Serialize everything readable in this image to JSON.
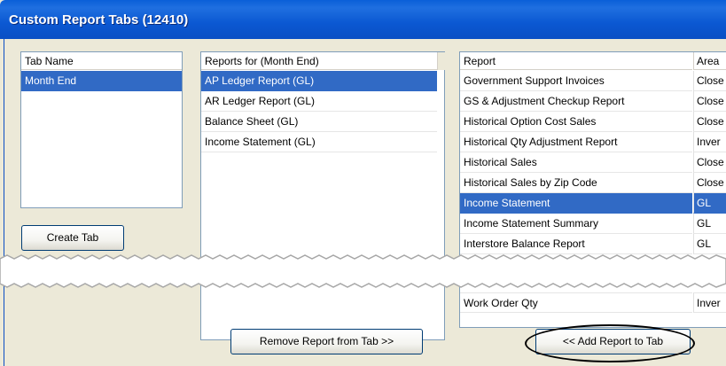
{
  "window": {
    "title": "Custom Report Tabs (12410)"
  },
  "tabs_list": {
    "header": "Tab Name",
    "items": [
      {
        "label": "Month End",
        "selected": true
      }
    ]
  },
  "create_tab_button": {
    "label": "Create Tab"
  },
  "reports_for_tab": {
    "header": "Reports for (Month End)",
    "items": [
      {
        "label": "AP Ledger Report (GL)",
        "selected": true
      },
      {
        "label": "AR Ledger Report (GL)"
      },
      {
        "label": "Balance Sheet (GL)"
      },
      {
        "label": "Income Statement (GL)"
      }
    ]
  },
  "remove_button": {
    "label": "Remove Report from Tab >>"
  },
  "all_reports": {
    "headers": {
      "report": "Report",
      "area": "Area"
    },
    "rows_before_break": [
      {
        "report": "Government Support Invoices",
        "area": "Close"
      },
      {
        "report": "GS & Adjustment Checkup Report",
        "area": "Close"
      },
      {
        "report": "Historical Option Cost Sales",
        "area": "Close"
      },
      {
        "report": "Historical Qty Adjustment Report",
        "area": "Inver"
      },
      {
        "report": "Historical Sales",
        "area": "Close"
      },
      {
        "report": "Historical Sales by Zip Code",
        "area": "Close"
      },
      {
        "report": "Income Statement",
        "area": "GL",
        "selected": true
      },
      {
        "report": "Income Statement Summary",
        "area": "GL"
      },
      {
        "report": "Interstore Balance Report",
        "area": "GL"
      }
    ],
    "rows_after_break": [
      {
        "report": "Work Order Qty",
        "area": "Inver"
      }
    ]
  },
  "add_button": {
    "label": "<< Add Report to Tab"
  },
  "colors": {
    "title_bar": "#0a5fd8",
    "selection": "#316ac5",
    "dialog_bg": "#ece9d8"
  }
}
